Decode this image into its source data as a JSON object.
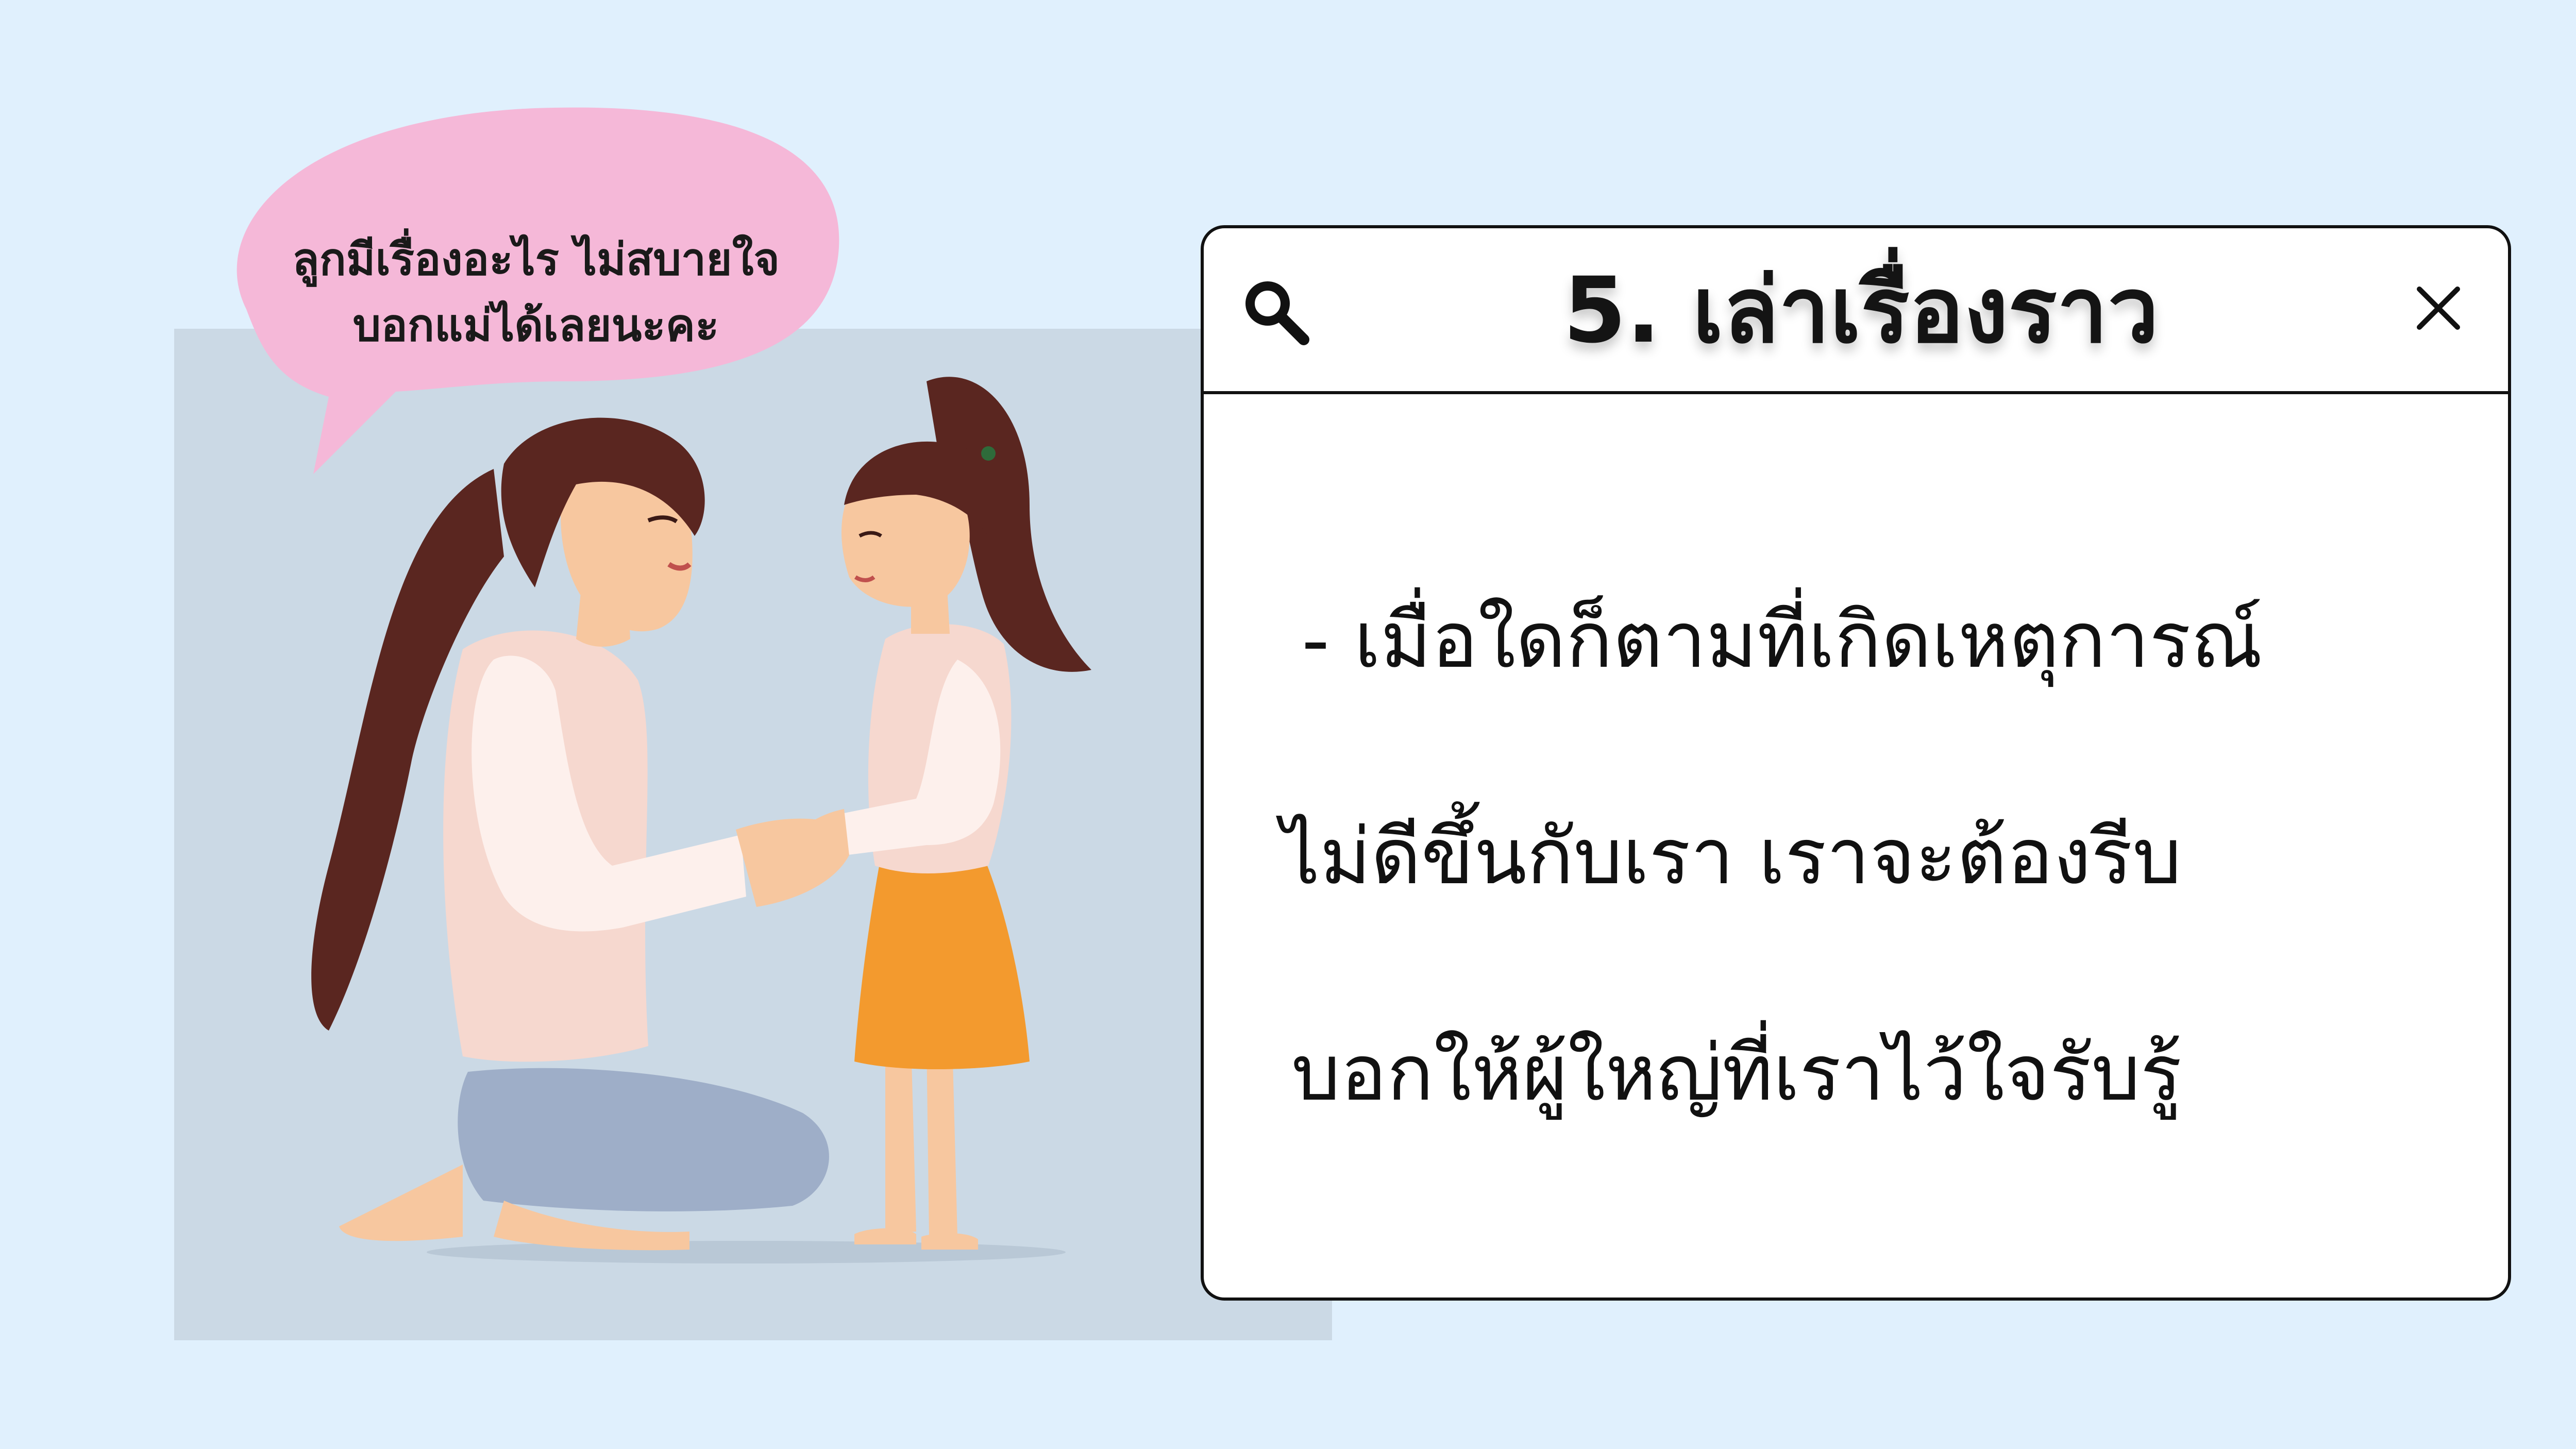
{
  "speech_bubble": {
    "line1": "ลูกมีเรื่องอะไร ไม่สบายใจ",
    "line2": "บอกแม่ได้เลยนะคะ"
  },
  "card": {
    "title": "5. เล่าเรื่องราว",
    "body_line1": "- เมื่อใดก็ตามที่เกิดเหตุการณ์",
    "body_line2": "ไม่ดีขึ้นกับเรา เราจะต้องรีบ",
    "body_line3": "บอกให้ผู้ใหญ่ที่เราไว้ใจรับรู้",
    "search_icon": "search-icon",
    "close_icon": "close-icon"
  },
  "colors": {
    "page_background": "#e0f0fd",
    "illustration_panel": "#cbd9e5",
    "speech_bubble": "#f5b8d8",
    "card_background": "#ffffff",
    "card_border": "#111111",
    "skirt_orange": "#f39a2e",
    "hair_brown": "#5a2620"
  }
}
